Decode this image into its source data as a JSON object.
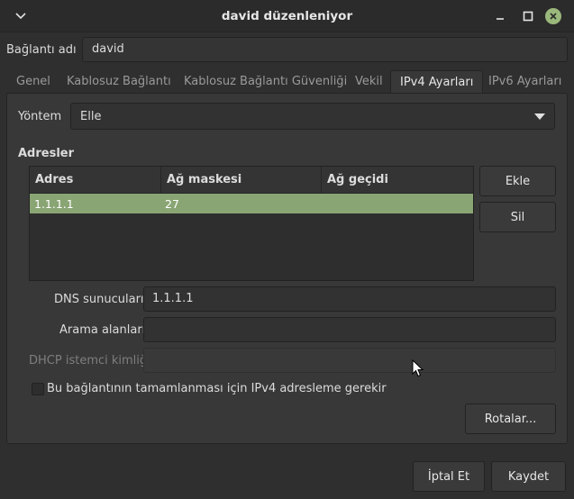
{
  "window": {
    "title": "david düzenleniyor",
    "controls": {
      "minimize_icon": "minimize-icon",
      "maximize_icon": "maximize-icon",
      "close_icon": "close-icon"
    }
  },
  "connection": {
    "label": "Bağlantı adı",
    "value": "david"
  },
  "tabs": [
    {
      "label": "Genel",
      "active": false
    },
    {
      "label": "Kablosuz Bağlantı",
      "active": false
    },
    {
      "label": "Kablosuz Bağlantı Güvenliği",
      "active": false
    },
    {
      "label": "Vekil",
      "active": false
    },
    {
      "label": "IPv4 Ayarları",
      "active": true
    },
    {
      "label": "IPv6 Ayarları",
      "active": false
    }
  ],
  "method": {
    "label": "Yöntem",
    "value": "Elle"
  },
  "addresses": {
    "heading": "Adresler",
    "columns": [
      "Adres",
      "Ağ maskesi",
      "Ağ geçidi"
    ],
    "rows": [
      {
        "address": "1.1.1.1",
        "netmask": "27",
        "gateway": ""
      }
    ],
    "add_label": "Ekle",
    "remove_label": "Sil"
  },
  "dns": {
    "label": "DNS sunucuları",
    "value": "1.1.1.1"
  },
  "search": {
    "label": "Arama alanları",
    "value": ""
  },
  "dhcp": {
    "label": "DHCP istemci kimliği",
    "value": ""
  },
  "require_ipv4": {
    "label": "Bu bağlantının tamamlanması için IPv4 adresleme gerekir",
    "checked": false
  },
  "routes_label": "Rotalar...",
  "footer": {
    "cancel_label": "İptal Et",
    "save_label": "Kaydet"
  },
  "colors": {
    "selection": "#8aa574",
    "close_button": "#9ab87c"
  }
}
